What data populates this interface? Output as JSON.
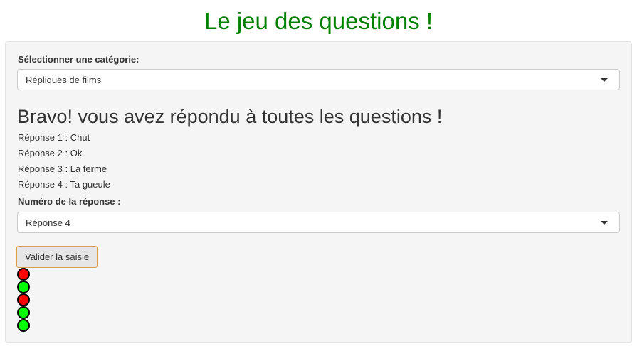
{
  "header": {
    "title": "Le jeu des questions !"
  },
  "category": {
    "label": "Sélectionner une catégorie:",
    "selected": "Répliques de films"
  },
  "result": {
    "message": "Bravo! vous avez répondu à toutes les questions !"
  },
  "answers": [
    "Réponse 1 : Chut",
    "Réponse 2 : Ok",
    "Réponse 3 : La ferme",
    "Réponse 4 : Ta gueule"
  ],
  "answer_select": {
    "label": "Numéro de la réponse :",
    "selected": "Réponse 4"
  },
  "validate_button": {
    "label": "Valider la saisie"
  },
  "results_dots": {
    "colors": [
      "#ff0000",
      "#00ff00",
      "#ff0000",
      "#00ff00",
      "#00ff00"
    ]
  },
  "colors": {
    "title": "#008000",
    "panel_background": "#f5f5f5",
    "wrong": "#ff0000",
    "right": "#00ff00"
  }
}
